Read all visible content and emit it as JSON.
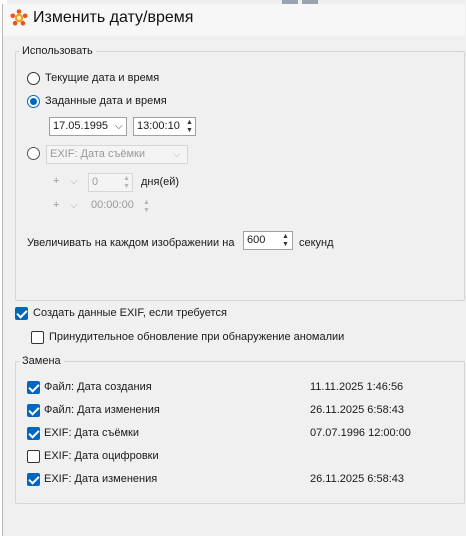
{
  "window": {
    "title": "Изменить дату/время",
    "icon": "app-logo-icon"
  },
  "use_group": {
    "legend": "Использовать",
    "option_current": "Текущие дата и время",
    "option_specified": "Заданные дата и время",
    "date_value": "17.05.1995",
    "time_value": "13:00:10",
    "option_exif": "EXIF: Дата съёмки",
    "sign1": "+",
    "days_value": "0",
    "days_label": "дня(ей)",
    "sign2": "+",
    "offset_time": "00:00:00",
    "increment_label": "Увеличивать на каждом изображении на",
    "increment_value": "600",
    "increment_unit": "секунд"
  },
  "create_exif": {
    "label": "Создать данные EXIF, если требуется",
    "checked": true
  },
  "force_update": {
    "label": "Принудительное обновление при обнаружение аномалии",
    "checked": false
  },
  "replace_group": {
    "legend": "Замена",
    "items": [
      {
        "label": "Файл: Дата создания",
        "value": "11.11.2025 1:46:56",
        "checked": true
      },
      {
        "label": "Файл: Дата изменения",
        "value": "26.11.2025 6:58:43",
        "checked": true
      },
      {
        "label": "EXIF: Дата съёмки",
        "value": "07.07.1996 12:00:00",
        "checked": true
      },
      {
        "label": "EXIF: Дата оцифровки",
        "value": "",
        "checked": false
      },
      {
        "label": "EXIF: Дата изменения",
        "value": "26.11.2025 6:58:43",
        "checked": true
      }
    ]
  },
  "colors": {
    "accent": "#0067c0",
    "background": "#f0f0f0",
    "disabled_text": "#9a9a9a"
  }
}
